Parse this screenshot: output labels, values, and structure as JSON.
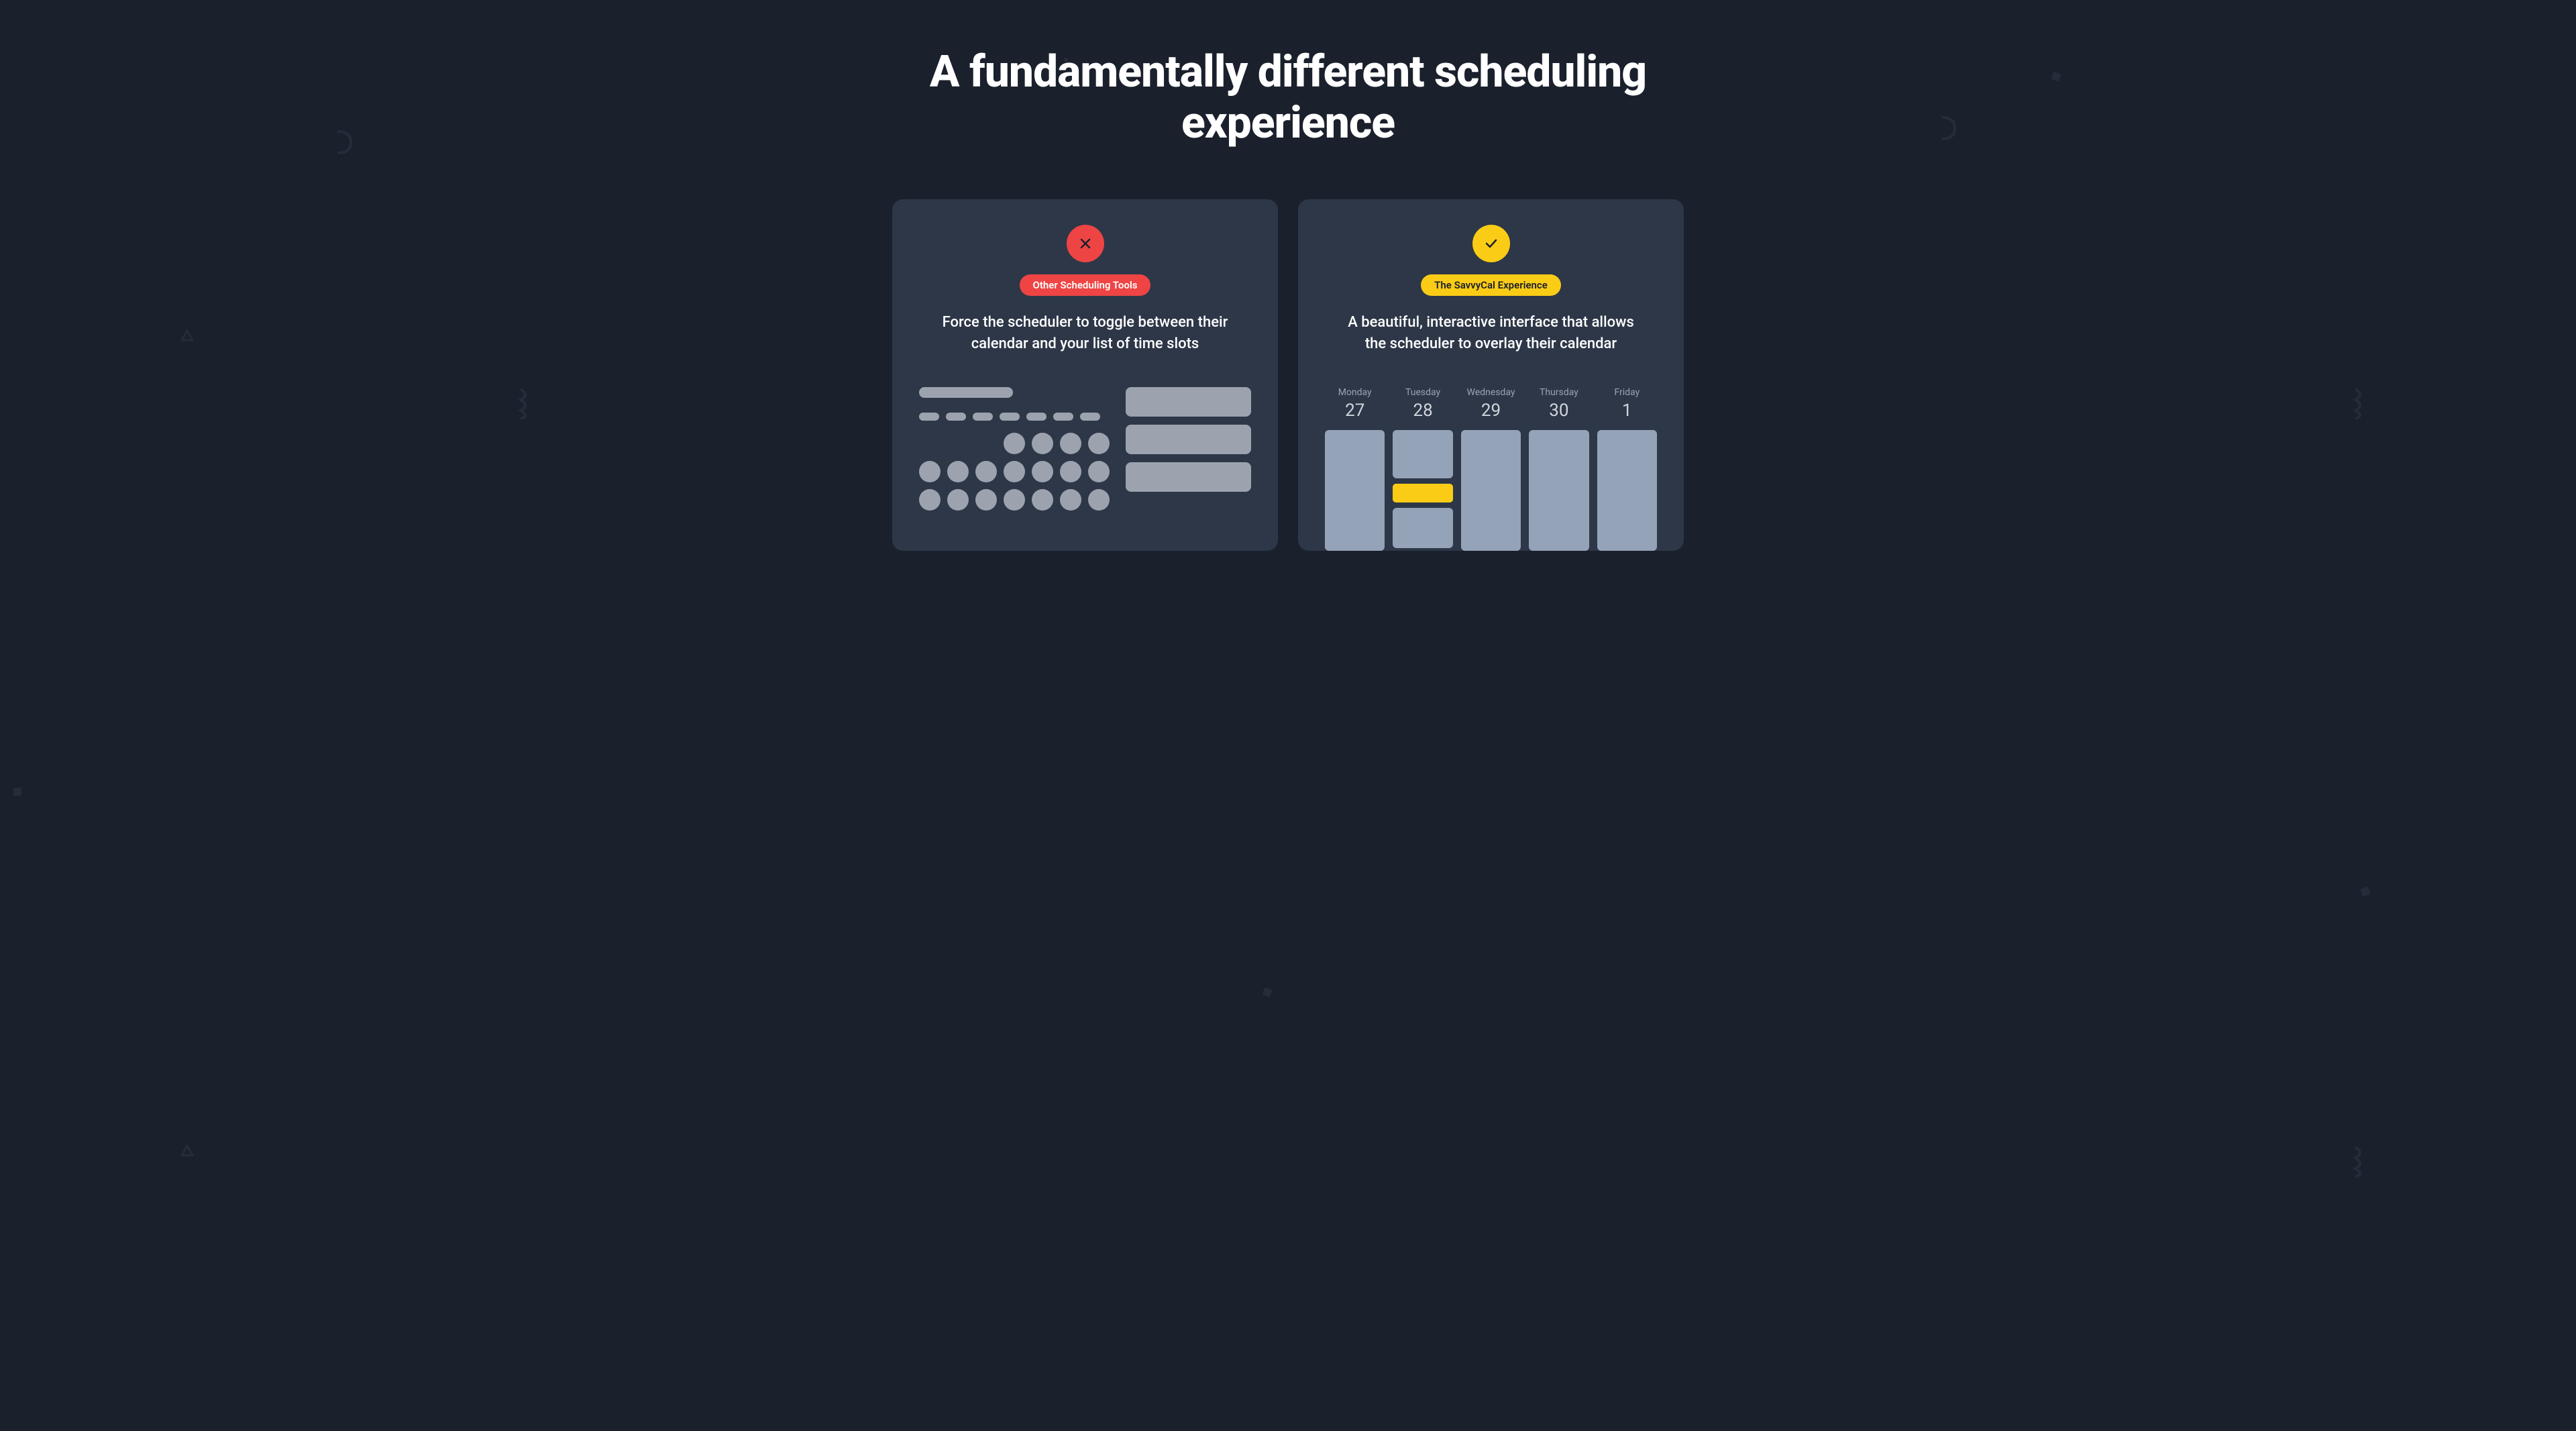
{
  "heading": "A fundamentally different scheduling experience",
  "left": {
    "badge": "Other Scheduling Tools",
    "desc": "Force the scheduler to toggle between their calendar and your list of time slots"
  },
  "right": {
    "badge": "The SavvyCal Experience",
    "desc": "A beautiful, interactive interface that allows the scheduler to overlay their calendar",
    "days": [
      {
        "name": "Monday",
        "num": "27"
      },
      {
        "name": "Tuesday",
        "num": "28"
      },
      {
        "name": "Wednesday",
        "num": "29"
      },
      {
        "name": "Thursday",
        "num": "30"
      },
      {
        "name": "Friday",
        "num": "1"
      }
    ]
  }
}
